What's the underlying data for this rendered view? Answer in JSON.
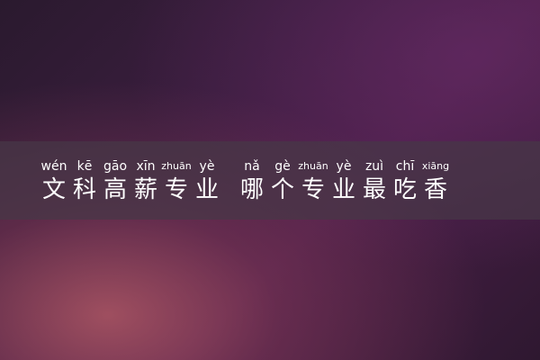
{
  "title": {
    "chars": [
      {
        "py": "wén",
        "hz": "文"
      },
      {
        "py": "kē",
        "hz": "科"
      },
      {
        "py": "gāo",
        "hz": "高"
      },
      {
        "py": "xīn",
        "hz": "薪"
      },
      {
        "py": "zhuān",
        "hz": "专"
      },
      {
        "py": "yè",
        "hz": "业"
      },
      {
        "py": "nǎ",
        "hz": "哪"
      },
      {
        "py": "gè",
        "hz": "个"
      },
      {
        "py": "zhuān",
        "hz": "专"
      },
      {
        "py": "yè",
        "hz": "业"
      },
      {
        "py": "zuì",
        "hz": "最"
      },
      {
        "py": "chī",
        "hz": "吃"
      },
      {
        "py": "xiāng",
        "hz": "香"
      }
    ]
  }
}
